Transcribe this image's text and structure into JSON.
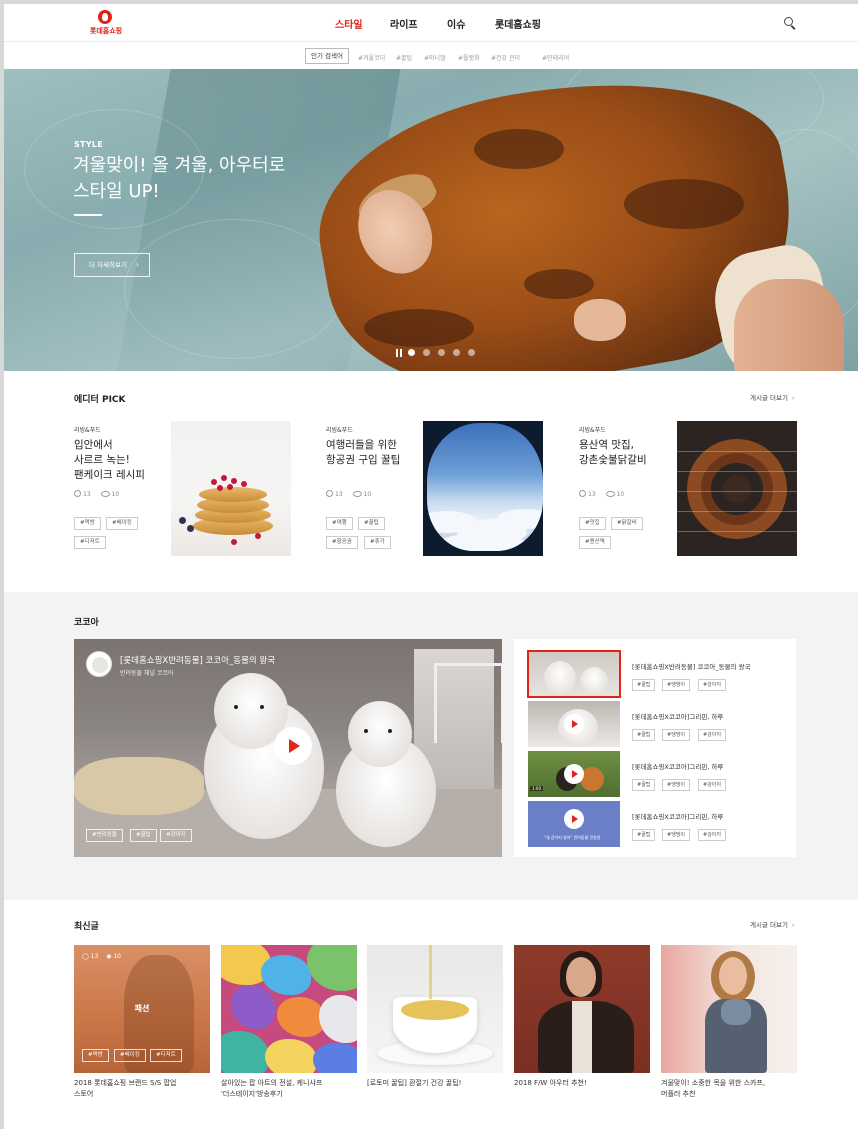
{
  "header": {
    "logo_text": "롯데홈쇼핑",
    "nav": [
      "스타일",
      "라이프",
      "이슈",
      "롯데홈쇼핑"
    ],
    "active_nav": "스타일"
  },
  "subnav": {
    "pill_label": "인기 검색어",
    "tags": [
      "#겨울코디",
      "#꿀팁",
      "#미니멀",
      "#플랫화",
      "#건강 관리",
      "#인테리어"
    ]
  },
  "hero": {
    "eyebrow": "STYLE",
    "title_lines": [
      "겨울맞이! 올 겨울, 아우터로",
      "스타일 UP!"
    ],
    "button_label": "더 자세히보기",
    "slide_count": 5,
    "active_slide": 1
  },
  "editor_pick": {
    "title": "에디터 PICK",
    "more_label": "게시글 더보기",
    "cards": [
      {
        "category": "리빙&푸드",
        "title_lines": [
          "입안에서",
          "사르르 녹는!",
          "팬케이크 레시피"
        ],
        "comments": "13",
        "views": "10",
        "tags": [
          "#먹방",
          "#베이킹",
          "#디저트"
        ],
        "image": "pancake"
      },
      {
        "category": "리빙&푸드",
        "title_lines": [
          "여행러들을 위한",
          "항공권 구입 꿀팁"
        ],
        "comments": "13",
        "views": "10",
        "tags": [
          "#여행",
          "#꿀팁",
          "#항공권",
          "#휴가"
        ],
        "image": "airplane-window"
      },
      {
        "category": "리빙&푸드",
        "title_lines": [
          "용산역 맛집,",
          "강촌숯불닭갈비"
        ],
        "comments": "13",
        "views": "10",
        "tags": [
          "#맛집",
          "#닭갈비",
          "#용산역"
        ],
        "image": "grill"
      }
    ]
  },
  "cocoa": {
    "title": "코코아",
    "main_video": {
      "title": "[롯데홈쇼핑X반려동물] 코코아_동물의 왕국",
      "channel": "반려동물 채널 코코아",
      "tags": [
        "#반려동물",
        "#꿀팁",
        "#강아지"
      ]
    },
    "playlist": [
      {
        "title": "[롯데홈쇼핑X반려동물] 코코아_동물의 왕국",
        "tags": [
          "#꿀팁",
          "#댕댕이",
          "#강아지"
        ],
        "selected": true
      },
      {
        "title": "[롯데홈쇼핑X코코아]그리핀, 하루",
        "tags": [
          "#꿀팁",
          "#댕댕이",
          "#강아지"
        ],
        "selected": false
      },
      {
        "title": "[롯데홈쇼핑X코코아]그리핀, 하루",
        "tags": [
          "#꿀팁",
          "#댕댕이",
          "#강아지"
        ],
        "selected": false,
        "stamp": "1:00"
      },
      {
        "title": "[롯데홈쇼핑X코코아]그리핀, 하루",
        "tags": [
          "#꿀팁",
          "#댕댕이",
          "#강아지"
        ],
        "selected": false,
        "thumb_text": "\"새 강아지 왔어\" 반려동물 전용관"
      }
    ]
  },
  "latest": {
    "title": "최신글",
    "more_label": "게시글 더보기",
    "cards": [
      {
        "caption_lines": [
          "2018 롯데홈쇼핑 브랜드 S/S 팝업",
          "스토어"
        ],
        "overlay_label": "패션",
        "comments": "13",
        "views": "10",
        "tags": [
          "#먹방",
          "#베이킹",
          "#디저트"
        ]
      },
      {
        "caption_lines": [
          "살아있는 팝 아트의 전설, 케니샤프",
          "'더스테이지'방송후기"
        ]
      },
      {
        "caption_lines": [
          "[로토미 꿀팁] 환절기 건강 꿀팁!"
        ]
      },
      {
        "caption_lines": [
          "2018 F/W 아우터 추천!"
        ]
      },
      {
        "caption_lines": [
          "겨울맞이! 소중한 목을 위한 스카프,",
          "머플러 추천"
        ]
      }
    ]
  },
  "colors": {
    "brand_red": "#e2231a"
  }
}
